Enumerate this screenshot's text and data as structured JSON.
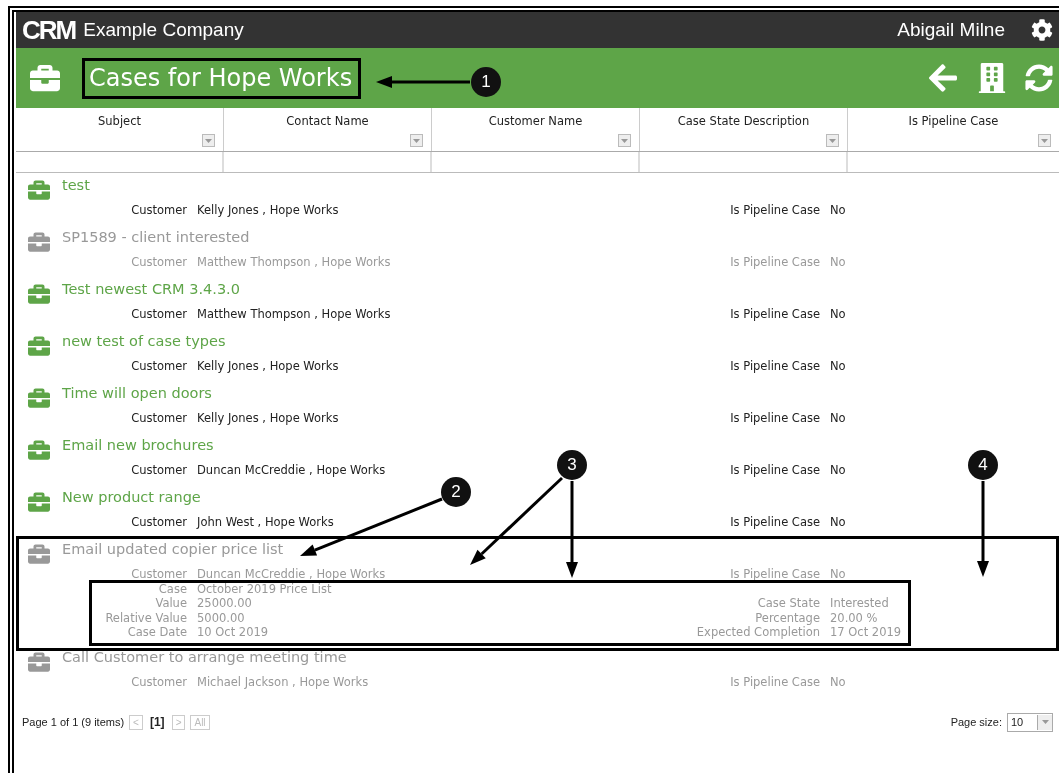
{
  "top_bar": {
    "logo": "CRM",
    "company": "Example Company",
    "user": "Abigail Milne"
  },
  "title_bar": {
    "title": "Cases for Hope Works"
  },
  "columns": [
    "Subject",
    "Contact Name",
    "Customer Name",
    "Case State Description",
    "Is Pipeline Case"
  ],
  "rows": [
    {
      "title": "test",
      "closed": false,
      "lines": [
        {
          "left": {
            "label": "Customer",
            "value": "Kelly Jones , Hope Works"
          },
          "right": {
            "label": "Is Pipeline Case",
            "value": "No"
          }
        }
      ]
    },
    {
      "title": "SP1589 - client interested",
      "closed": true,
      "lines": [
        {
          "left": {
            "label": "Customer",
            "value": "Matthew Thompson , Hope Works"
          },
          "right": {
            "label": "Is Pipeline Case",
            "value": "No"
          }
        }
      ]
    },
    {
      "title": "Test newest CRM 3.4.3.0",
      "closed": false,
      "lines": [
        {
          "left": {
            "label": "Customer",
            "value": "Matthew Thompson , Hope Works"
          },
          "right": {
            "label": "Is Pipeline Case",
            "value": "No"
          }
        }
      ]
    },
    {
      "title": "new test of case types",
      "closed": false,
      "lines": [
        {
          "left": {
            "label": "Customer",
            "value": "Kelly Jones , Hope Works"
          },
          "right": {
            "label": "Is Pipeline Case",
            "value": "No"
          }
        }
      ]
    },
    {
      "title": "Time will open doors",
      "closed": false,
      "lines": [
        {
          "left": {
            "label": "Customer",
            "value": "Kelly Jones , Hope Works"
          },
          "right": {
            "label": "Is Pipeline Case",
            "value": "No"
          }
        }
      ]
    },
    {
      "title": "Email new brochures",
      "closed": false,
      "lines": [
        {
          "left": {
            "label": "Customer",
            "value": "Duncan McCreddie , Hope Works"
          },
          "right": {
            "label": "Is Pipeline Case",
            "value": "No"
          }
        }
      ]
    },
    {
      "title": "New product range",
      "closed": false,
      "lines": [
        {
          "left": {
            "label": "Customer",
            "value": "John West , Hope Works"
          },
          "right": {
            "label": "Is Pipeline Case",
            "value": "No"
          }
        }
      ]
    },
    {
      "title": "Email updated copier price list",
      "closed": true,
      "lines": [
        {
          "left": {
            "label": "Customer",
            "value": "Duncan McCreddie , Hope Works"
          },
          "right": {
            "label": "Is Pipeline Case",
            "value": "No"
          }
        },
        {
          "left": {
            "label": "Case",
            "value": "October 2019 Price List"
          }
        },
        {
          "left": {
            "label": "Value",
            "value": "25000.00"
          },
          "right": {
            "label": "Case State",
            "value": "Interested"
          }
        },
        {
          "left": {
            "label": "Relative Value",
            "value": "5000.00"
          },
          "right": {
            "label": "Percentage",
            "value": "20.00 %"
          }
        },
        {
          "left": {
            "label": "Case Date",
            "value": "10 Oct 2019"
          },
          "right": {
            "label": "Expected Completion",
            "value": "17 Oct 2019"
          }
        }
      ]
    },
    {
      "title": "Call Customer to arrange meeting time",
      "closed": true,
      "lines": [
        {
          "left": {
            "label": "Customer",
            "value": "Michael Jackson , Hope Works"
          },
          "right": {
            "label": "Is Pipeline Case",
            "value": "No"
          }
        }
      ]
    }
  ],
  "pager": {
    "summary": "Page 1 of 1 (9 items)",
    "prev": "<",
    "current": "[1]",
    "next": ">",
    "all": "All",
    "page_size_label": "Page size:",
    "page_size": "10"
  },
  "callouts": [
    {
      "label": "1"
    },
    {
      "label": "2"
    },
    {
      "label": "3"
    },
    {
      "label": "4"
    }
  ]
}
